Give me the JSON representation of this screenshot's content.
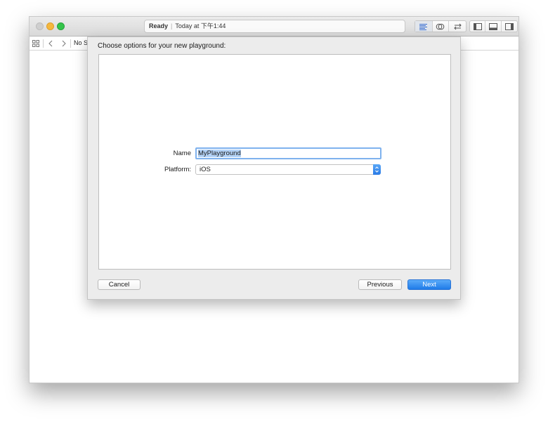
{
  "activity": {
    "status": "Ready",
    "separator": "|",
    "timestamp": "Today at 下午1:44"
  },
  "toolbar": {
    "editor_icons": [
      "standard-editor-icon",
      "assistant-editor-icon",
      "version-editor-icon"
    ],
    "view_icons": [
      "navigator-toggle-icon",
      "debug-area-toggle-icon",
      "utilities-toggle-icon"
    ]
  },
  "navbar": {
    "jump_text": "No Se"
  },
  "sheet": {
    "title": "Choose options for your new playground:",
    "name_label": "Name",
    "name_value": "MyPlayground",
    "platform_label": "Platform:",
    "platform_value": "iOS",
    "cancel_label": "Cancel",
    "previous_label": "Previous",
    "next_label": "Next"
  },
  "colors": {
    "accent": "#2a7be6",
    "selection": "#b4d3f7",
    "focus_ring": "#7fb2ee"
  }
}
